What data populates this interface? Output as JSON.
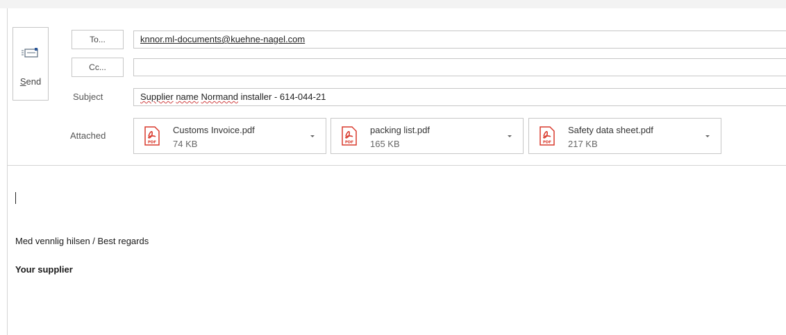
{
  "header": {
    "send_label_prefix": "S",
    "send_label_rest": "end",
    "to_button_label": "To...",
    "cc_button_label": "Cc...",
    "to_value": "knnor.ml-documents@kuehne-nagel.com",
    "cc_value": "",
    "subject_label": "Subject",
    "subject_word1": "Supplier",
    "subject_word2": "name",
    "subject_word3": "Normand",
    "subject_rest": " installer - 614-044-21",
    "attached_label": "Attached"
  },
  "attachments": [
    {
      "name": "Customs Invoice.pdf",
      "size": "74 KB",
      "icon": "pdf-icon"
    },
    {
      "name": "packing list.pdf",
      "size": "165 KB",
      "icon": "pdf-icon"
    },
    {
      "name": "Safety data sheet.pdf",
      "size": "217 KB",
      "icon": "pdf-icon"
    }
  ],
  "body": {
    "signature_line": "Med vennlig hilsen / Best regards",
    "signature_name": "Your supplier"
  },
  "colors": {
    "pdf_red": "#d9392c",
    "border": "#c6c6c6"
  }
}
